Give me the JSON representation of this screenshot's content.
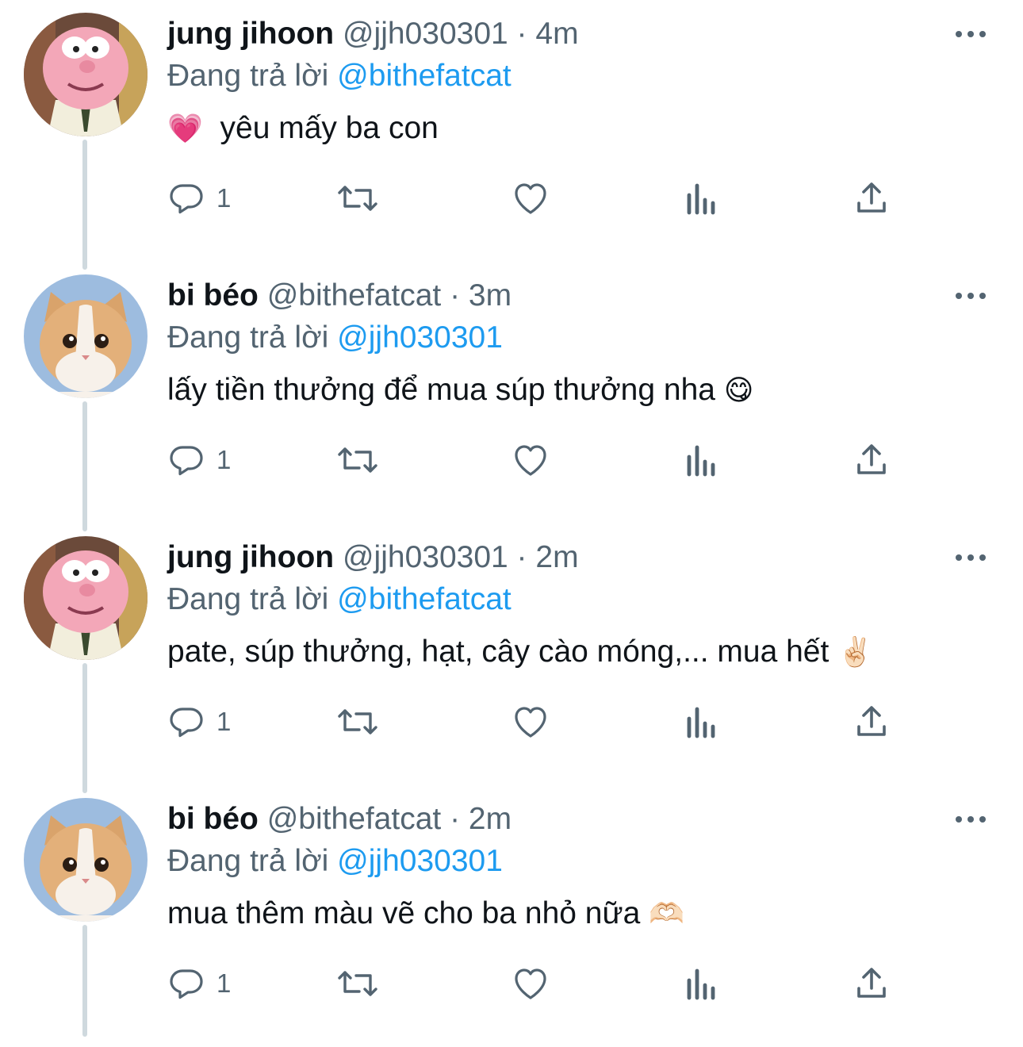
{
  "tweets": [
    {
      "name": "jung jihoon",
      "handle": "@jjh030301",
      "sep": "·",
      "time": "4m",
      "reply_prefix": "Đang trả lời",
      "reply_to": "@bithefatcat",
      "text": "yêu mấy ba con",
      "emoji_before": "💗",
      "emoji_after": "",
      "reply_count": "1",
      "avatar": "gumball-pink-character"
    },
    {
      "name": "bi béo",
      "handle": "@bithefatcat",
      "sep": "·",
      "time": "3m",
      "reply_prefix": "Đang trả lời",
      "reply_to": "@jjh030301",
      "text": "lấy tiền thưởng để mua súp thưởng nha",
      "emoji_before": "",
      "emoji_after": "😋",
      "reply_count": "1",
      "avatar": "cream-cat"
    },
    {
      "name": "jung jihoon",
      "handle": "@jjh030301",
      "sep": "·",
      "time": "2m",
      "reply_prefix": "Đang trả lời",
      "reply_to": "@bithefatcat",
      "text": "pate, súp thưởng, hạt, cây cào móng,... mua hết",
      "emoji_before": "",
      "emoji_after": "✌🏻",
      "reply_count": "1",
      "avatar": "gumball-pink-character"
    },
    {
      "name": "bi béo",
      "handle": "@bithefatcat",
      "sep": "·",
      "time": "2m",
      "reply_prefix": "Đang trả lời",
      "reply_to": "@jjh030301",
      "text": "mua thêm màu vẽ cho ba nhỏ nữa",
      "emoji_before": "",
      "emoji_after": "🫶🏻",
      "reply_count": "1",
      "avatar": "cream-cat"
    }
  ],
  "icons": {
    "more": "more-horizontal-icon",
    "reply": "speech-bubble-icon",
    "retweet": "retweet-icon",
    "like": "heart-icon",
    "views": "bar-chart-icon",
    "share": "share-upload-icon"
  },
  "colors": {
    "text": "#0f1419",
    "secondary": "#536471",
    "link": "#1d9bf0",
    "thread_line": "#cfd9de"
  }
}
